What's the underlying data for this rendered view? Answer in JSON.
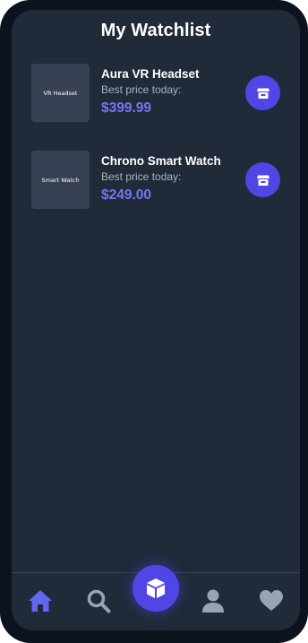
{
  "header": {
    "title": "My Watchlist"
  },
  "watchlist": [
    {
      "thumbnail_label": "VR Headset",
      "name": "Aura VR Headset",
      "price_label": "Best price today:",
      "price": "$399.99",
      "action_icon": "store-icon"
    },
    {
      "thumbnail_label": "Smart Watch",
      "name": "Chrono Smart Watch",
      "price_label": "Best price today:",
      "price": "$249.00",
      "action_icon": "store-icon"
    }
  ],
  "bottom_nav": {
    "items": [
      "home-icon",
      "search-icon",
      "cube-icon",
      "user-icon",
      "heart-icon"
    ],
    "active": "home-icon"
  },
  "colors": {
    "background": "#202a39",
    "frame": "#0d131e",
    "accent": "#5046e6",
    "price": "#7476f2",
    "active_nav": "#6366f1",
    "inactive_nav": "#9aa3b0"
  }
}
